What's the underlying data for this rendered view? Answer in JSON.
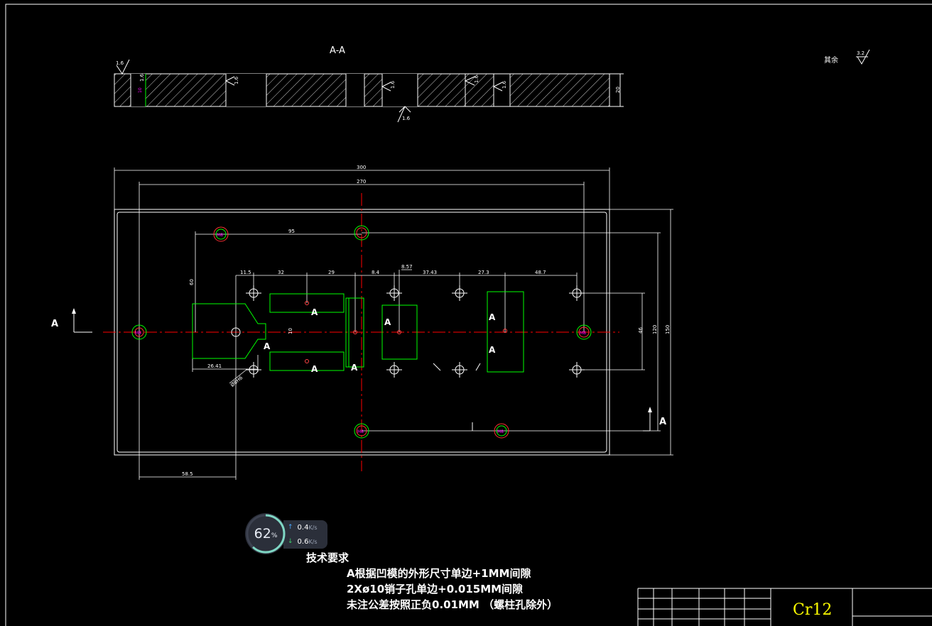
{
  "section_label": "A-A",
  "view_marker": "A",
  "roughness_other": "其余",
  "roughness_other_value": "3.2",
  "roughness_values": [
    "1.6"
  ],
  "hole_marker": "A",
  "dimensions": {
    "overall_length": "300",
    "hole_span": "270",
    "d95": "95",
    "d60": "60",
    "d115": "11.5",
    "d32": "32",
    "d29": "29",
    "d84": "8.4",
    "d857": "8.57",
    "d3743": "37.43",
    "d273": "27.3",
    "d487": "48.7",
    "d2641": "26.41",
    "d585": "58.5",
    "d46": "46",
    "d120": "120",
    "d150": "150",
    "thickness": "20",
    "d10": "10",
    "diam_label": "Ø8H6"
  },
  "tech_requirements": {
    "title": "技术要求",
    "items": [
      "A根据凹模的外形尺寸单边+1MM间隙",
      "2Xø10销子孔单边+0.015MM间隙",
      "未注公差按照正负0.01MM （螺柱孔除外）"
    ]
  },
  "title_block": {
    "material": "Cr12"
  },
  "monitor": {
    "percent": "62",
    "percent_unit": "%",
    "upload": "0.4",
    "download": "0.6",
    "unit": "K/s",
    "ring_fraction": 0.62
  },
  "colors": {
    "outline": "#ffffff",
    "contour": "#00ff00",
    "centerline": "#ff0000",
    "dimension_text": "#ff00ff",
    "material_text": "#ffff00"
  }
}
